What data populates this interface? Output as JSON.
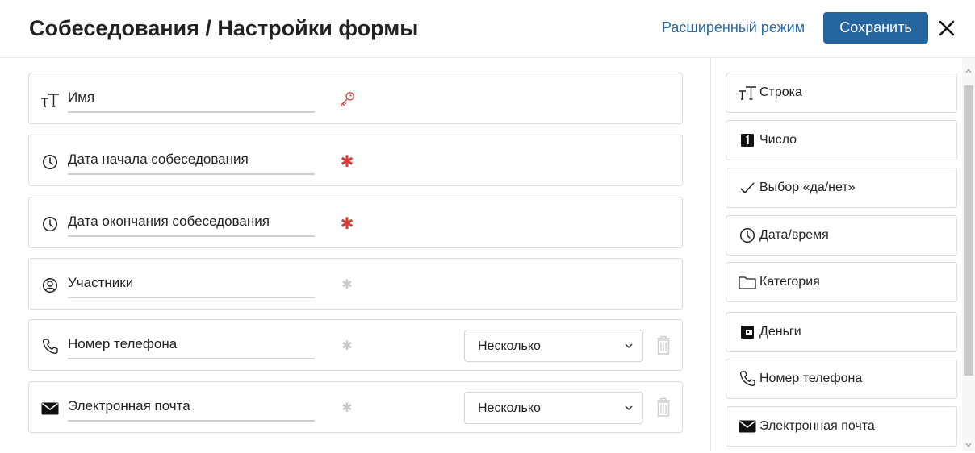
{
  "header": {
    "title": "Собеседования / Настройки формы",
    "advanced_link": "Расширенный режим",
    "save_label": "Сохранить",
    "accent_color": "#2566a1"
  },
  "fields": [
    {
      "name": "Имя",
      "icon": "text-tt-icon",
      "marker": "key-icon"
    },
    {
      "name": "Дата начала собеседования",
      "icon": "clock-icon",
      "marker": "required-star",
      "required": true
    },
    {
      "name": "Дата окончания собеседования",
      "icon": "clock-icon",
      "marker": "required-star",
      "required": true
    },
    {
      "name": "Участники",
      "icon": "user-circle-icon",
      "marker": "optional-star",
      "required": false
    },
    {
      "name": "Номер телефона",
      "icon": "phone-icon",
      "marker": "optional-star",
      "required": false,
      "select": "Несколько"
    },
    {
      "name": "Электронная почта",
      "icon": "envelope-icon",
      "marker": "optional-star",
      "required": false,
      "select": "Несколько"
    }
  ],
  "toolbox": [
    {
      "label": "Строка",
      "icon": "text-tt-icon"
    },
    {
      "label": "Число",
      "icon": "number-one-icon"
    },
    {
      "label": "Выбор «да/нет»",
      "icon": "checkmark-icon"
    },
    {
      "label": "Дата/время",
      "icon": "clock-icon"
    },
    {
      "label": "Категория",
      "icon": "folder-icon"
    },
    {
      "label": "Деньги",
      "icon": "wallet-icon"
    },
    {
      "label": "Номер телефона",
      "icon": "phone-icon"
    },
    {
      "label": "Электронная почта",
      "icon": "envelope-icon"
    }
  ]
}
